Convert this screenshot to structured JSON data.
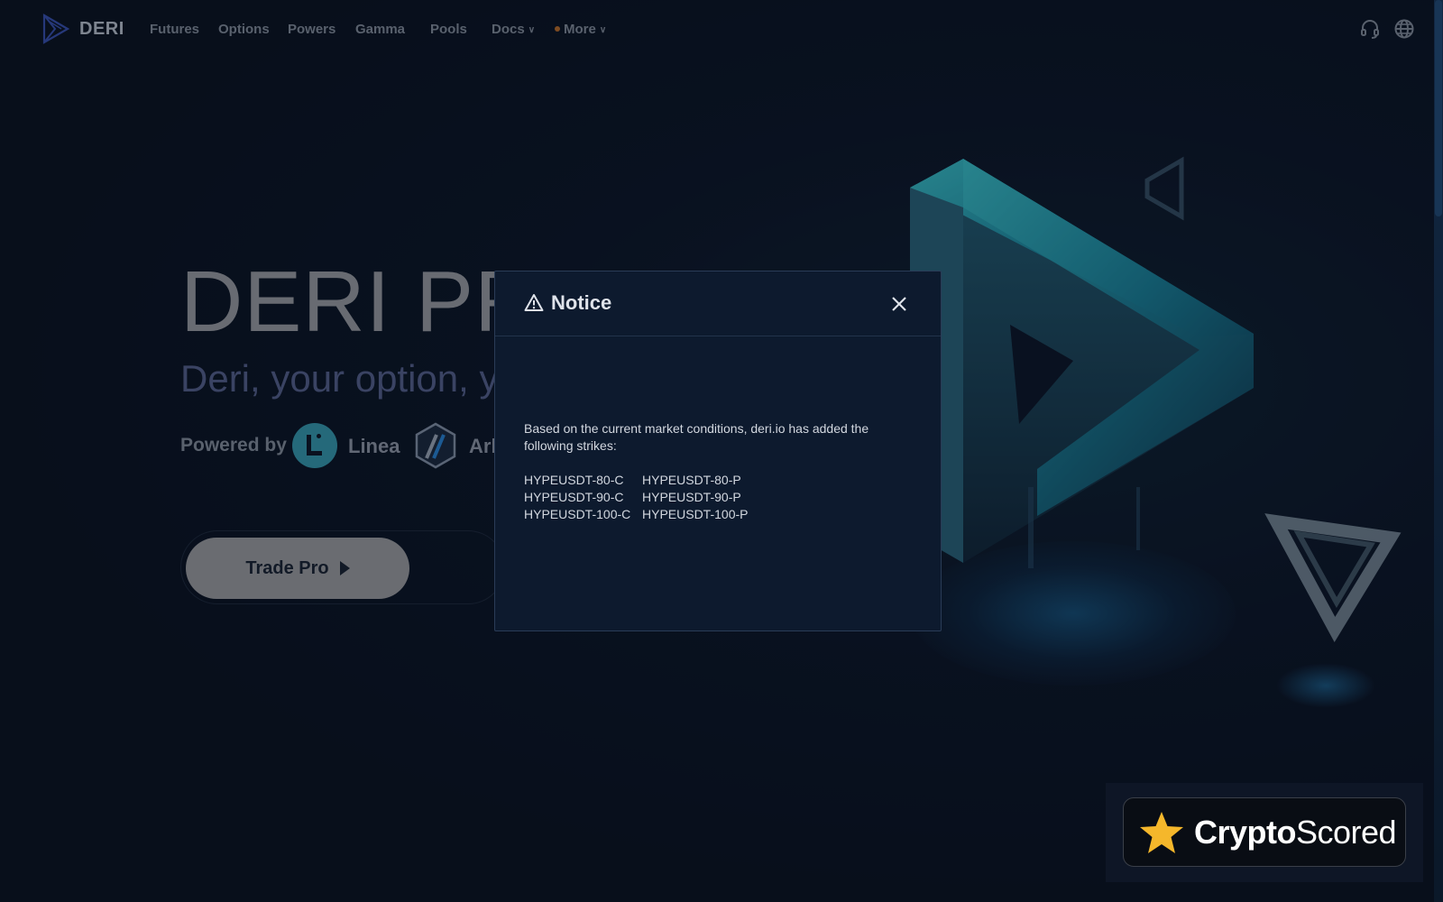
{
  "nav": {
    "brand": "DERI",
    "links": [
      "Futures",
      "Options",
      "Powers",
      "Gamma",
      "Pools",
      "Docs",
      "More"
    ]
  },
  "hero": {
    "title": "DERI PRO",
    "subtitle": "Deri, your option, your",
    "powered_by": "Powered by",
    "partners": [
      "Linea",
      "Arb"
    ],
    "cta": "Trade Pro"
  },
  "modal": {
    "title": "Notice",
    "message": "Based on the current market conditions, deri.io has added the following strikes:",
    "strikes": [
      "HYPEUSDT-80-C",
      "HYPEUSDT-80-P",
      "HYPEUSDT-90-C",
      "HYPEUSDT-90-P",
      "HYPEUSDT-100-C",
      "HYPEUSDT-100-P"
    ]
  },
  "badge": {
    "brand_bold": "Crypto",
    "brand_light": "Scored"
  },
  "icons": [
    "logo-icon",
    "headset-icon",
    "globe-icon",
    "warning-icon",
    "close-icon",
    "play-icon",
    "star-icon",
    "chevron-down-icon"
  ],
  "colors": {
    "background": "#0b1322",
    "modal": "#0d1a2e",
    "cta": "#a8a8aa",
    "accent_dot": "#c9742a",
    "linea": "#39a3b8"
  }
}
